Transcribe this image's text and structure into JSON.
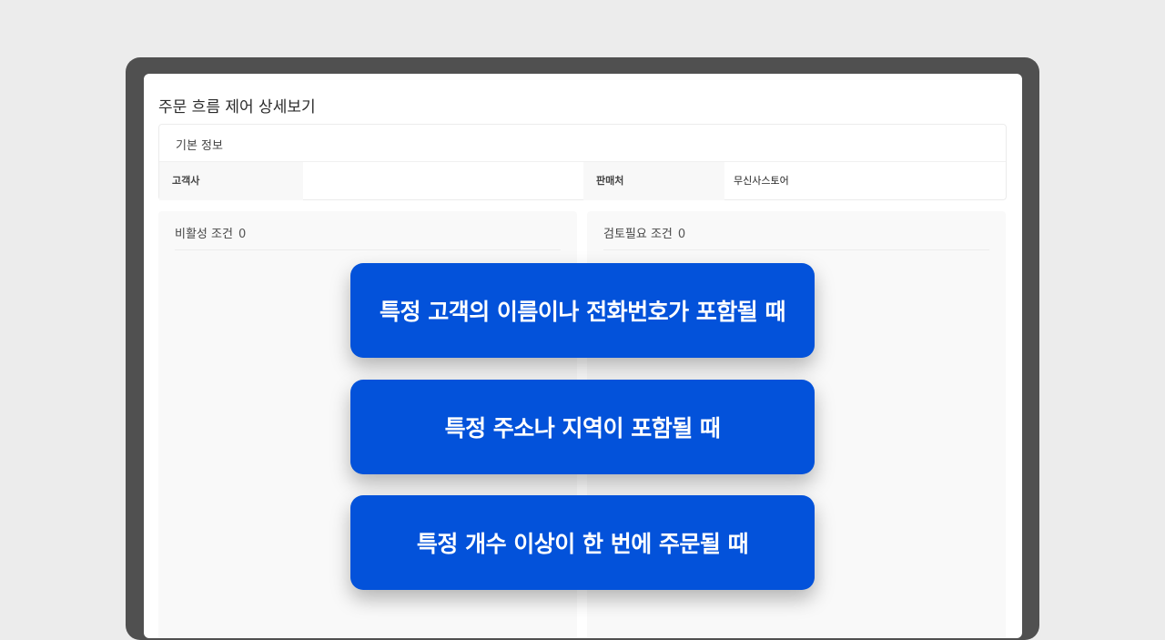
{
  "page": {
    "title": "주문 흐름 제어 상세보기"
  },
  "basic_info": {
    "title": "기본 정보",
    "customer_label": "고객사",
    "customer_value": "",
    "seller_label": "판매처",
    "seller_value": "무신사스토어"
  },
  "conditions": {
    "inactive": {
      "label": "비활성 조건",
      "count": "0"
    },
    "review": {
      "label": "검토필요 조건",
      "count": "0"
    }
  },
  "features": [
    {
      "text": "특정 고객의 이름이나 전화번호가 포함될 때"
    },
    {
      "text": "특정 주소나 지역이 포함될 때"
    },
    {
      "text": "특정 개수 이상이 한 번에 주문될 때"
    }
  ],
  "colors": {
    "accent": "#0352da",
    "frame": "#505050",
    "background": "#ececec"
  }
}
